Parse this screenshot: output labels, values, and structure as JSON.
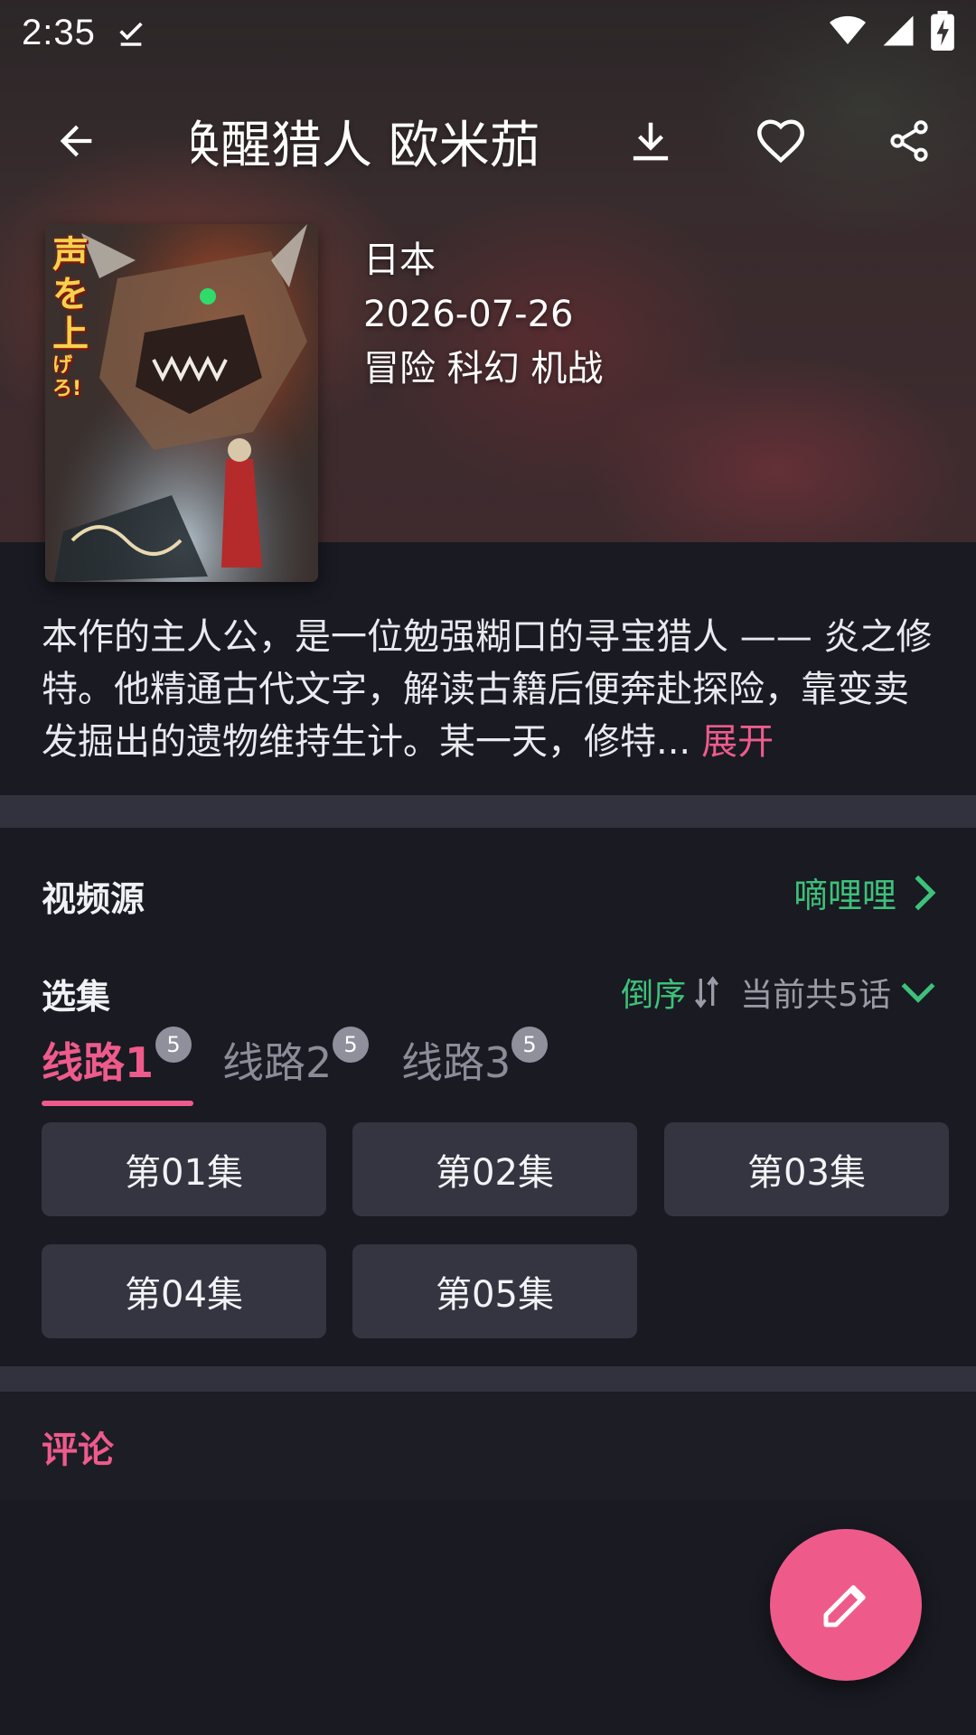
{
  "status_bar": {
    "time": "2:35",
    "icons": [
      "download-done-icon",
      "wifi-icon",
      "signal-icon",
      "battery-charging-icon"
    ]
  },
  "toolbar": {
    "title": "唤醒猎人 欧米茄",
    "icons": [
      "back-arrow-icon",
      "download-icon",
      "heart-icon",
      "share-icon"
    ]
  },
  "poster": {
    "caption_top": "声を",
    "caption_mid": "上",
    "caption_end": "げろ!"
  },
  "meta": {
    "region": "日本",
    "date": "2026-07-26",
    "genres": "冒险 科幻 机战"
  },
  "synopsis": {
    "text": "本作的主人公，是一位勉强糊口的寻宝猎人 —— 炎之修特。他精通古代文字，解读古籍后便奔赴探险，靠变卖发掘出的遗物维持生计。某一天，修特...",
    "expand_label": "展开"
  },
  "video_source": {
    "label": "视频源",
    "value": "嘀哩哩"
  },
  "episodes": {
    "label": "选集",
    "sort_label": "倒序",
    "count_label": "当前共5话",
    "tabs": [
      {
        "label": "线路1",
        "badge": "5",
        "active": true
      },
      {
        "label": "线路2",
        "badge": "5",
        "active": false
      },
      {
        "label": "线路3",
        "badge": "5",
        "active": false
      }
    ],
    "items": [
      "第01集",
      "第02集",
      "第03集",
      "第04集",
      "第05集"
    ]
  },
  "comments": {
    "label": "评论"
  },
  "colors": {
    "accent_pink": "#ee5b8b",
    "accent_green": "#3ec17a",
    "background": "#191a22",
    "episode_button": "#343540"
  }
}
